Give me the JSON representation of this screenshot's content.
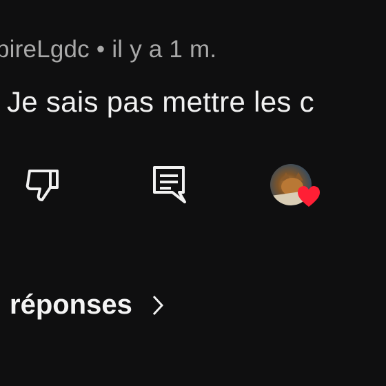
{
  "comment": {
    "author": "pireLgdc",
    "separator": "•",
    "time": "il y a 1 m.",
    "text": ". Je sais pas mettre les c"
  },
  "actions": {
    "dislike_icon": "thumbs-down-icon",
    "reply_icon": "comment-icon",
    "creator_heart_icon": "heart-icon",
    "heart_color": "#ff1f35"
  },
  "replies": {
    "label": "réponses",
    "chevron_icon": "chevron-right-icon"
  }
}
